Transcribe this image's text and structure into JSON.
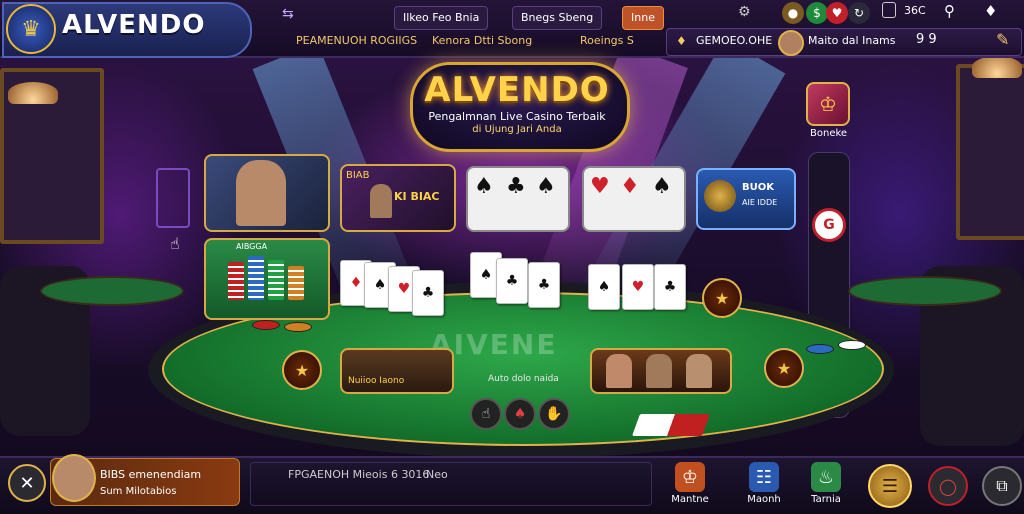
{
  "header": {
    "brand": "ALVENDO",
    "logo_icon": "crest-icon",
    "chip_left": "Ilkeo Feo Bnia",
    "chip_mid": "Bnegs Sbeng",
    "chip_right": "Inne",
    "sublinks": [
      "PEAMENUOH ROGIIGS",
      "Kenora Dtti Sbong",
      "Roeings S"
    ],
    "status_count": "36C",
    "user": {
      "promo": "GEMOEO.OHE",
      "name": "Maito dal Inams",
      "balance": "9 9"
    }
  },
  "title": {
    "main": "ALVENDO",
    "line1": "Pengalmnan Live Casino Terbaik",
    "line2": "di Ujung Jari Anda"
  },
  "games": {
    "promo_card_label": "KI BIAC",
    "promo_card_small": "BIAB",
    "side_badge": "Boneke",
    "left_badge": "AIBGGA",
    "right_panel_line1": "BUOK",
    "right_panel_line2": "AIE IDDE"
  },
  "table": {
    "felt_text": "AIVENE",
    "felt_subtext": "Auto dolo naida",
    "left_panel": "Nuiioo Iaono",
    "controls": [
      "tap-icon",
      "spade-icon",
      "hand-icon"
    ]
  },
  "footer": {
    "player_line1": "BIBS  emenendiam",
    "player_line2": "Sum Milotabios",
    "status_a": "FPGAENOH Mieois 6 3016",
    "status_b": "Neo",
    "nav": [
      {
        "label": "Mantne",
        "icon": "trophy-icon"
      },
      {
        "label": "Maonh",
        "icon": "cart-icon"
      },
      {
        "label": "Tarnia",
        "icon": "gift-icon"
      }
    ]
  },
  "colors": {
    "gold": "#e0b24a",
    "felt": "#1f8a3a",
    "accent_red": "#d0202a",
    "topbar": "#1c1030"
  }
}
